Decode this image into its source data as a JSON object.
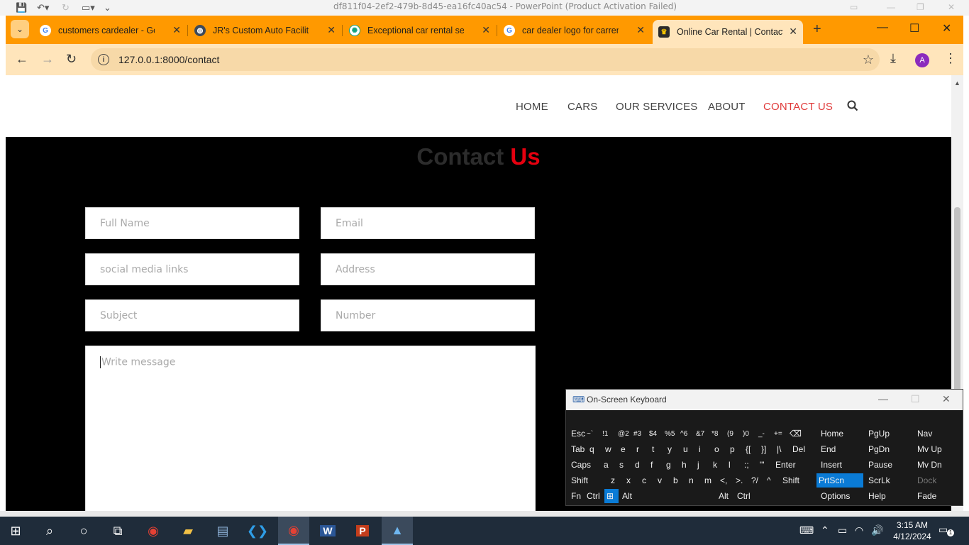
{
  "powerpoint": {
    "title": "df811f04-2ef2-479b-8d45-ea16fc40ac54 - PowerPoint (Product Activation Failed)"
  },
  "browser": {
    "tabs": [
      {
        "title": "customers cardealer - Goog",
        "favicon": "google-icon"
      },
      {
        "title": "JR's Custom Auto Facilities",
        "favicon": "globe-icon"
      },
      {
        "title": "Exceptional car rental servic",
        "favicon": "chatgpt-icon"
      },
      {
        "title": "car dealer logo for carrental",
        "favicon": "google-icon"
      },
      {
        "title": "Online Car Rental | Contact",
        "favicon": "site-icon",
        "active": true
      }
    ],
    "url": "127.0.0.1:8000/contact",
    "profile_initial": "A"
  },
  "site": {
    "nav": {
      "home": "HOME",
      "cars": "CARS",
      "services": "OUR SERVICES",
      "about": "ABOUT",
      "contact": "CONTACT US"
    },
    "heading": {
      "part1": "Contact",
      "part2": "Us"
    },
    "form": {
      "full_name": "Full Name",
      "email": "Email",
      "social": "social media links",
      "address": "Address",
      "subject": "Subject",
      "number": "Number",
      "message": "Write message"
    },
    "accent_color": "#e5000f"
  },
  "osk": {
    "title": "On-Screen Keyboard",
    "rows": [
      [
        "Esc",
        "~`",
        "!1",
        "@2",
        "#3",
        "$4",
        "%5",
        "^6",
        "&7",
        "*8",
        "(9",
        ")0",
        "_-",
        "+=",
        "⌫"
      ],
      [
        "Tab",
        "q",
        "w",
        "e",
        "r",
        "t",
        "y",
        "u",
        "i",
        "o",
        "p",
        "{[",
        "}]",
        "|\\",
        "Del"
      ],
      [
        "Caps",
        "a",
        "s",
        "d",
        "f",
        "g",
        "h",
        "j",
        "k",
        "l",
        ":;",
        "\"'",
        "Enter"
      ],
      [
        "Shift",
        "z",
        "x",
        "c",
        "v",
        "b",
        "n",
        "m",
        "<,",
        ">.",
        "?/",
        "^",
        "Shift"
      ],
      [
        "Fn",
        "Ctrl",
        "Alt",
        "Alt",
        "Ctrl"
      ]
    ],
    "side": {
      "home": "Home",
      "pgup": "PgUp",
      "nav": "Nav",
      "end": "End",
      "pgdn": "PgDn",
      "mvup": "Mv Up",
      "insert": "Insert",
      "pause": "Pause",
      "mvdn": "Mv Dn",
      "prtscn": "PrtScn",
      "scrlk": "ScrLk",
      "dock": "Dock",
      "options": "Options",
      "help": "Help",
      "fade": "Fade"
    }
  },
  "taskbar": {
    "time": "3:15 AM",
    "date": "4/12/2024",
    "notifications": "1"
  }
}
